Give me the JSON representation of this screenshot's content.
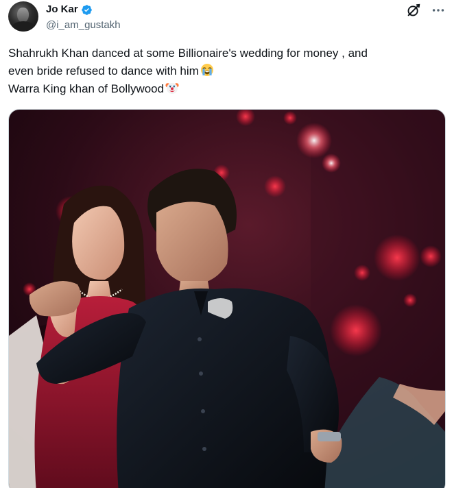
{
  "author": {
    "display_name": "Jo Kar",
    "handle": "@i_am_gustakh",
    "verified": true
  },
  "tweet": {
    "line1": "Shahrukh Khan danced at some Billionaire's wedding for money , and",
    "line2": "even bride refused to dance with him",
    "line2_emoji": "face-crying-loudly-emoji",
    "line3": "Warra King khan of Bollywood",
    "line3_emoji": "clown-face-emoji"
  },
  "icons": {
    "grok": "grok-icon",
    "more": "more-icon",
    "verified": "verified-badge-icon"
  },
  "colors": {
    "verified_blue": "#1d9bf0",
    "secondary_text": "#536471",
    "primary_text": "#0f1419",
    "media_background": "#2a0d18"
  }
}
